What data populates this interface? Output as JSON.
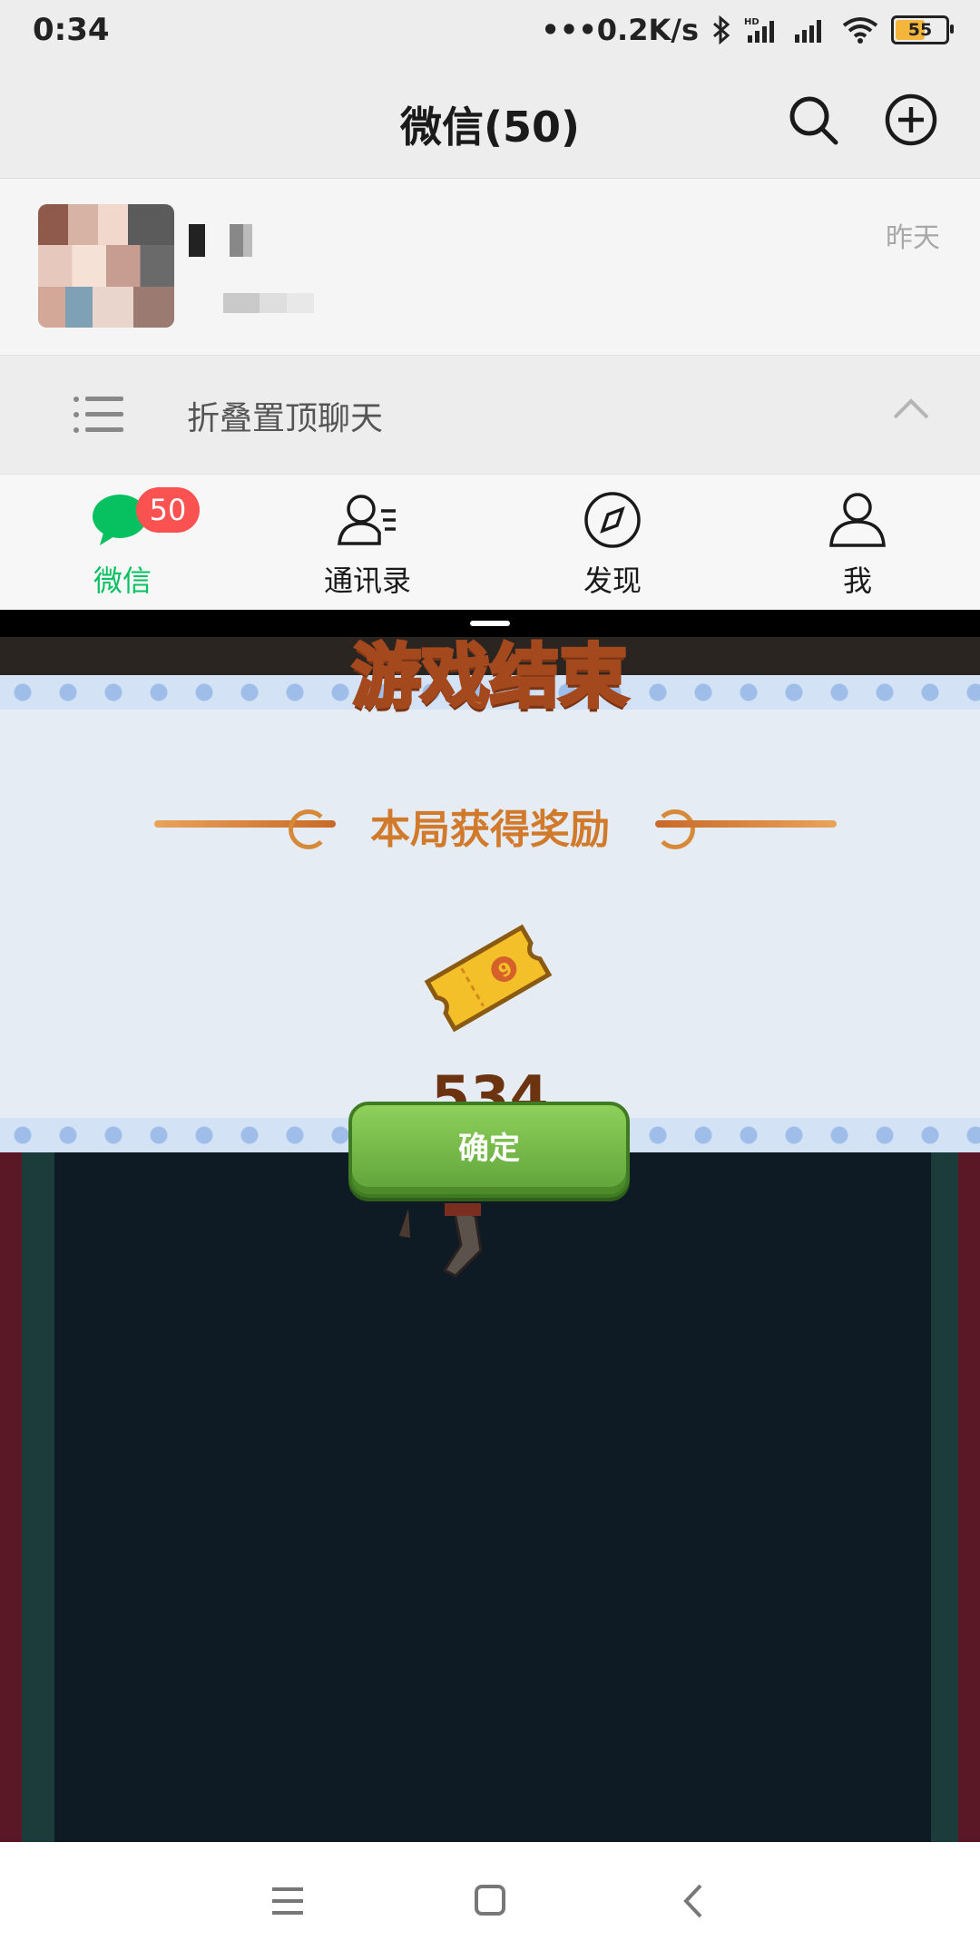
{
  "status_bar": {
    "time": "0:34",
    "network_speed": "•••0.2K/s",
    "battery": "55",
    "icons": [
      "bluetooth-icon",
      "hd-signal-icon",
      "signal-icon",
      "wifi-icon",
      "battery-icon"
    ]
  },
  "header": {
    "title": "微信(50)",
    "search_icon": "search-icon",
    "add_icon": "plus-circle-icon"
  },
  "chats": [
    {
      "name": "▪▫",
      "preview": "▫▫",
      "time": "昨天"
    }
  ],
  "fold_row": {
    "label": "折叠置顶聊天",
    "icon": "list-icon",
    "chevron": "chevron-up-icon"
  },
  "tabs": [
    {
      "label": "微信",
      "icon": "chat-icon",
      "badge": "50",
      "active": true
    },
    {
      "label": "通讯录",
      "icon": "contacts-icon"
    },
    {
      "label": "发现",
      "icon": "compass-icon"
    },
    {
      "label": "我",
      "icon": "person-icon"
    }
  ],
  "game": {
    "title": "游戏结束",
    "reward_title": "本局获得奖励",
    "reward_icon": "ticket-icon",
    "reward_count": "534",
    "confirm_label": "确定"
  },
  "nav": {
    "icons": [
      "menu-icon",
      "home-icon",
      "back-icon"
    ]
  },
  "colors": {
    "wechat_green": "#07c160",
    "badge_red": "#fa5151",
    "game_panel": "#e6ecf4",
    "button_green": "#6fb742"
  }
}
